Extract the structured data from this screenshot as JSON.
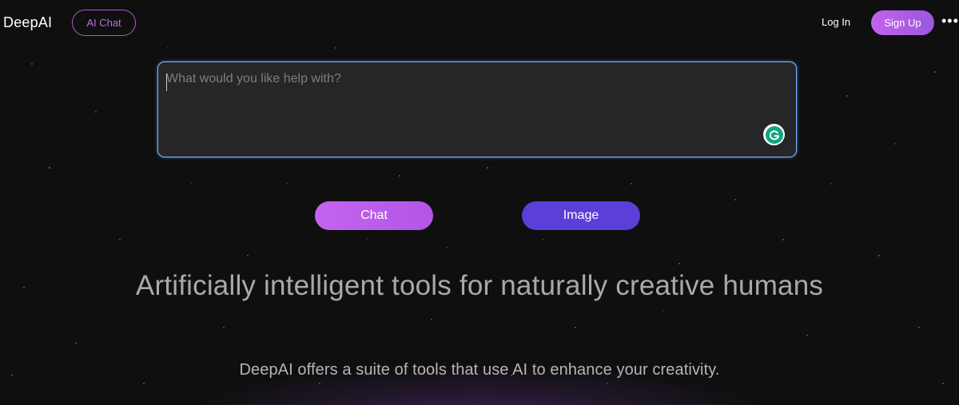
{
  "header": {
    "logo": "DeepAI",
    "ai_chat_label": "AI Chat",
    "login_label": "Log In",
    "signup_label": "Sign Up",
    "more_icon": "more-horizontal-icon",
    "more_glyph": "•••"
  },
  "prompt": {
    "placeholder": "What would you like help with?",
    "value": "",
    "grammarly_icon": "grammarly-icon",
    "grammarly_glyph": "G"
  },
  "actions": {
    "chat_label": "Chat",
    "image_label": "Image"
  },
  "hero": {
    "headline": "Artificially intelligent tools for naturally creative humans",
    "subline": "DeepAI offers a suite of tools that use AI to enhance your creativity."
  },
  "colors": {
    "background": "#0f0f10",
    "accent_pink": "#c264ea",
    "accent_purple": "#5b3fd8",
    "focus_blue": "#6fb3ff",
    "grammarly_green": "#15a37f"
  }
}
